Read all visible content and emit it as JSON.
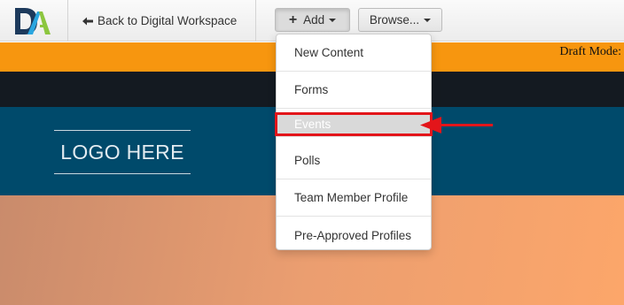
{
  "toolbar": {
    "logo": {
      "letters": "DA",
      "colors": {
        "navy": "#1d3a5c",
        "blue": "#2aa6e0",
        "green": "#8cc63f"
      }
    },
    "back_link": {
      "icon": "arrow-left-icon",
      "label": "Back to Digital Workspace"
    },
    "add_button": {
      "icon": "plus-icon",
      "label": "Add",
      "state": "open"
    },
    "browse_button": {
      "label": "Browse..."
    }
  },
  "draft_bar": {
    "text": "Draft Mode:",
    "color": "#f7960f"
  },
  "site_header": {
    "logo_placeholder": "LOGO HERE",
    "band_color": "#004a6b",
    "nav_color": "#141a21"
  },
  "add_menu": {
    "items": [
      {
        "label": "New Content"
      },
      {
        "label": "Forms"
      },
      {
        "label": "Events",
        "highlighted": true
      },
      {
        "label": "Polls"
      },
      {
        "label": "Team Member Profile"
      },
      {
        "label": "Pre-Approved Profiles"
      }
    ]
  },
  "annotation": {
    "type": "red-box-and-arrow",
    "target": "Events",
    "color": "#e3151a"
  }
}
